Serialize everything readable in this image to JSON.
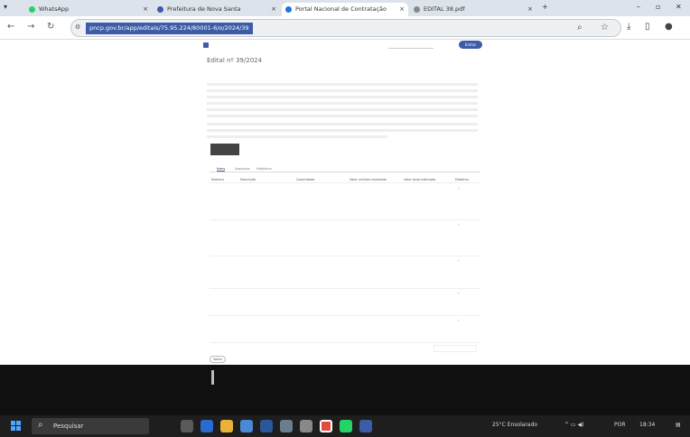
{
  "browser": {
    "tabs": [
      {
        "label": "WhatsApp",
        "active": false
      },
      {
        "label": "Prefeitura de Nova Santa",
        "active": false
      },
      {
        "label": "Portal Nacional de Contratação",
        "active": true
      },
      {
        "label": "EDITAL 38.pdf",
        "active": false
      }
    ],
    "new_tab": "+",
    "url": "pncp.gov.br/app/editais/75.95.224/80001-6/o/2024/39"
  },
  "site": {
    "title": "Edital nº 39/2024",
    "login": "Entrar",
    "tabs": [
      "Itens",
      "Arquivos",
      "Histórico"
    ],
    "columns": [
      "Número",
      "Descrição",
      "Quantidade",
      "Valor unitário estimado",
      "Valor total estimado",
      "Detalhar"
    ],
    "back": "Voltar"
  },
  "taskbar": {
    "search": "Pesquisar",
    "weather": "25°C  Ensolarado",
    "lang": "POR",
    "time": "18:34"
  }
}
